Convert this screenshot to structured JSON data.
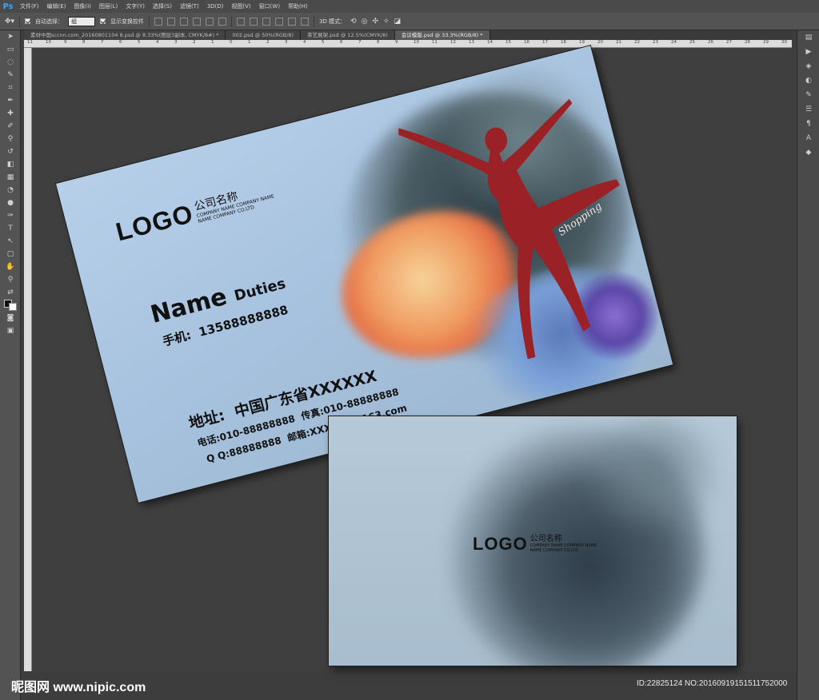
{
  "app": {
    "logo": "Ps",
    "menus": [
      "文件(F)",
      "编辑(E)",
      "图像(I)",
      "图层(L)",
      "文字(Y)",
      "选择(S)",
      "滤镜(T)",
      "3D(D)",
      "视图(V)",
      "窗口(W)",
      "帮助(H)"
    ]
  },
  "options": {
    "auto_select_label": "自动选择：",
    "auto_select_value": "组",
    "show_transform_label": "显示变换控件",
    "mode_3d_label": "3D 模式："
  },
  "tabs": [
    {
      "label": "素材中国sccnn.com_20160801104 8.psd @ 8.33%(图层3副本, CMYK/8#) *",
      "active": false
    },
    {
      "label": "002.psd @ 50%(RGB/8)",
      "active": false
    },
    {
      "label": "茶艺展架.psd @ 12.5%(CMYK/8)",
      "active": false
    },
    {
      "label": "会议模版.psd @ 33.3%(RGB/8) *",
      "active": true
    }
  ],
  "ruler": [
    "11",
    "10",
    "9",
    "8",
    "7",
    "6",
    "5",
    "4",
    "3",
    "2",
    "1",
    "0",
    "1",
    "2",
    "3",
    "4",
    "5",
    "6",
    "7",
    "8",
    "9",
    "10",
    "11",
    "12",
    "13",
    "14",
    "15",
    "16",
    "17",
    "18",
    "19",
    "20",
    "21",
    "22",
    "23",
    "24",
    "25",
    "26",
    "27",
    "28",
    "29",
    "30"
  ],
  "card_front": {
    "logo": "LOGO",
    "company_cn": "公司名称",
    "company_en1": "COMPANY NAME COMPANY NAME",
    "company_en2": "NAME COMPANY CO.LTD",
    "name": "Name",
    "duties": "Duties",
    "mobile": "手机:  13588888888",
    "address": "地址:  中国广东省XXXXXX",
    "phone_fax": "电话:010-88888888  传真:010-88888888",
    "qq_mail": "Q Q:88888888  邮箱:XXXXXX@163.com",
    "script_word": "Shopping"
  },
  "card_back": {
    "logo": "LOGO",
    "company_cn": "公司名称",
    "company_en1": "COMPANY NAME COMPANY NAME",
    "company_en2": "NAME COMPANY CO.LTD"
  },
  "watermark": {
    "site": "昵图网 www.nipic.com",
    "id": "ID:22825124 NO:20160919151511752000"
  },
  "colors": {
    "ps_blue": "#31a8ff",
    "dancer_red": "#9a2226",
    "card_blue": "#a8c3df"
  }
}
